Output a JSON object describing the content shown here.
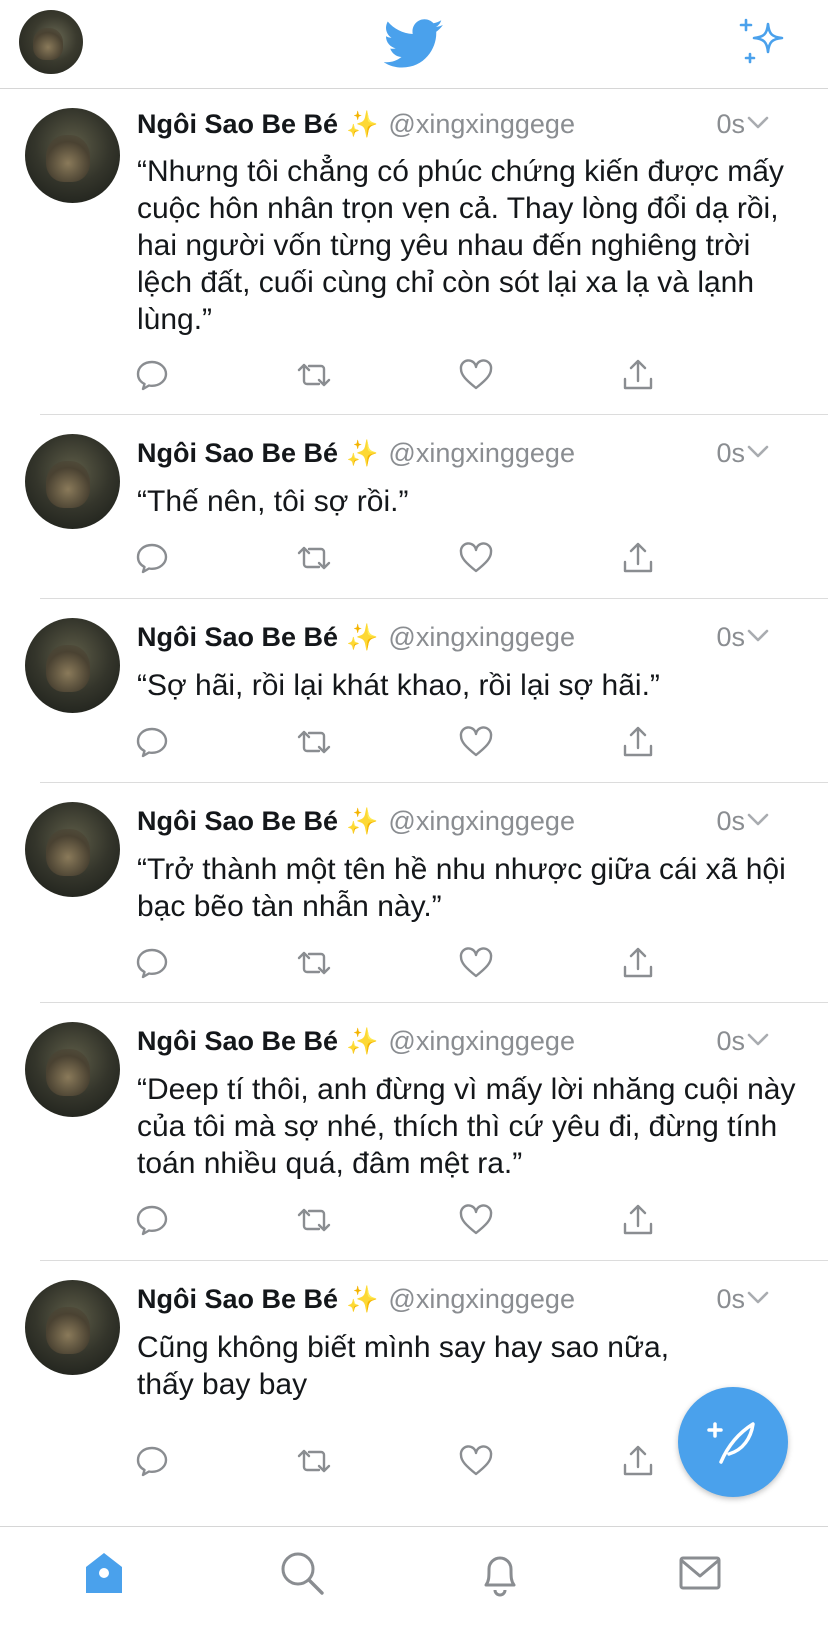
{
  "header": {
    "title_icon": "twitter-bird-icon",
    "compose_icon": "sparkle-icon"
  },
  "colors": {
    "accent": "#4aa1ec",
    "text": "#14171a",
    "muted": "#8a8d91"
  },
  "tweets": [
    {
      "name": "Ngôi Sao Be Bé",
      "badge": "✨",
      "handle": "@xingxinggege",
      "time": "0s",
      "text": "“Nhưng tôi chẳng có phúc chứng kiến được mấy cuộc hôn nhân trọn vẹn cả. Thay lòng đổi dạ rồi, hai người vốn từng yêu nhau đến nghiêng trời lệch đất, cuối cùng chỉ còn sót lại xa lạ và lạnh lùng.”"
    },
    {
      "name": "Ngôi Sao Be Bé",
      "badge": "✨",
      "handle": "@xingxinggege",
      "time": "0s",
      "text": "“Thế nên, tôi sợ rồi.”"
    },
    {
      "name": "Ngôi Sao Be Bé",
      "badge": "✨",
      "handle": "@xingxinggege",
      "time": "0s",
      "text": "“Sợ hãi, rồi lại khát khao, rồi lại sợ hãi.”"
    },
    {
      "name": "Ngôi Sao Be Bé",
      "badge": "✨",
      "handle": "@xingxinggege",
      "time": "0s",
      "text": "“Trở thành một tên hề nhu nhược giữa cái xã hội bạc bẽo tàn nhẫn này.”"
    },
    {
      "name": "Ngôi Sao Be Bé",
      "badge": "✨",
      "handle": "@xingxinggege",
      "time": "0s",
      "text": "“Deep tí thôi, anh đừng vì mấy lời nhăng cuội này của tôi mà sợ nhé, thích thì cứ yêu đi, đừng tính toán nhiều quá, đâm mệt ra.”"
    },
    {
      "name": "Ngôi Sao Be Bé",
      "badge": "✨",
      "handle": "@xingxinggege",
      "time": "0s",
      "text": "Cũng không biết mình say hay sao nữa, thấy bay bay"
    }
  ],
  "bottom_nav": [
    "home-icon",
    "search-icon",
    "bell-icon",
    "mail-icon"
  ],
  "fab": {
    "icon": "compose-feather-icon"
  }
}
